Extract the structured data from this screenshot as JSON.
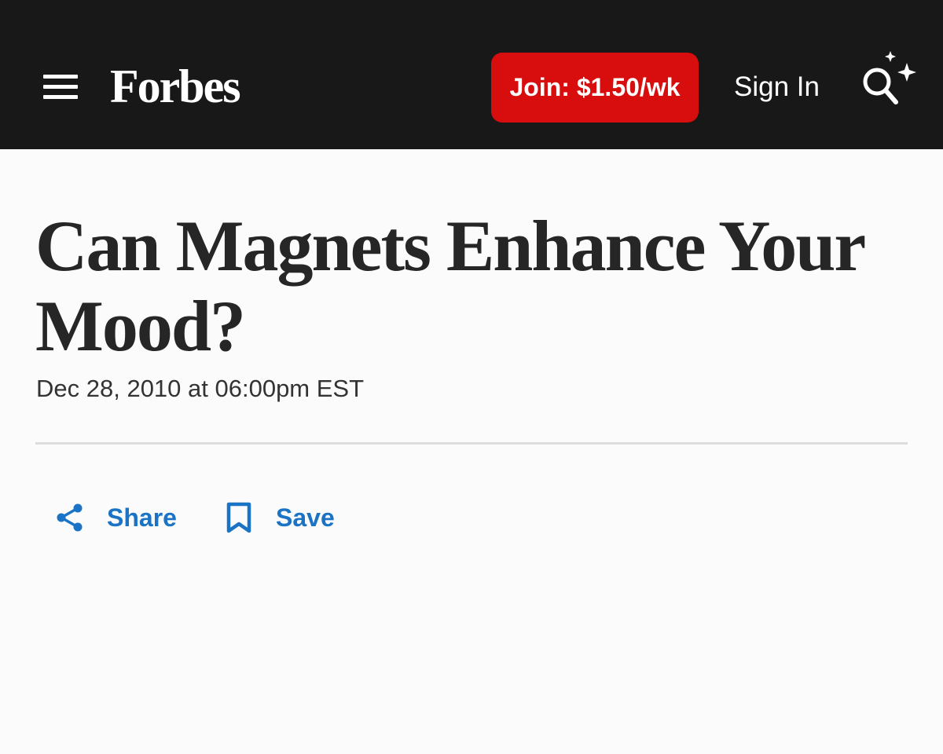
{
  "header": {
    "logo": "Forbes",
    "join_label": "Join: $1.50/wk",
    "signin_label": "Sign In"
  },
  "article": {
    "title": "Can Magnets Enhance Your Mood?",
    "date": "Dec 28, 2010 at 06:00pm EST"
  },
  "actions": {
    "share_label": "Share",
    "save_label": "Save"
  },
  "colors": {
    "header_bg": "#181818",
    "join_button": "#d80d0d",
    "action_blue": "#1a73c4",
    "page_bg": "#fbfbfb"
  },
  "icons": {
    "menu": "hamburger-icon",
    "search": "search-sparkle-icon",
    "share": "share-icon",
    "save": "bookmark-icon"
  }
}
